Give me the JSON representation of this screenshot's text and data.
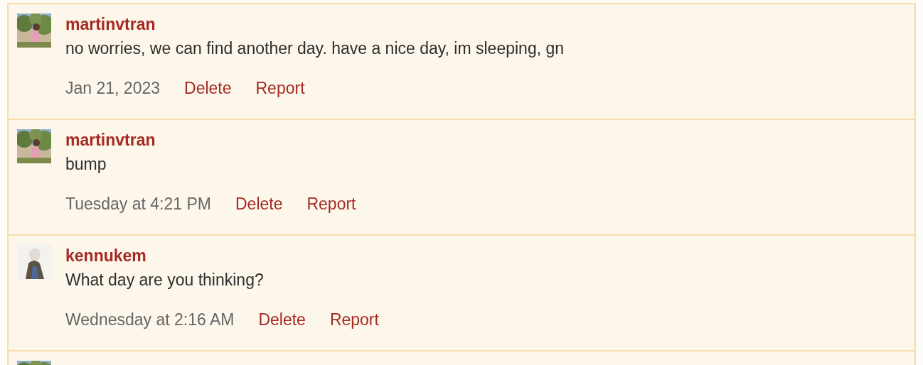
{
  "comments": [
    {
      "avatar": {
        "kind": "picture"
      },
      "username": "martinvtran",
      "text": "no worries, we can find another day. have a nice day, im sleeping, gn",
      "time": "Jan 21, 2023",
      "actions": [
        "Delete",
        "Report"
      ]
    },
    {
      "avatar": {
        "kind": "picture"
      },
      "username": "martinvtran",
      "text": "bump",
      "time": "Tuesday at 4:21 PM",
      "actions": [
        "Delete",
        "Report"
      ]
    },
    {
      "avatar": {
        "kind": "picture"
      },
      "username": "kennukem",
      "text": "What day are you thinking?",
      "time": "Wednesday at 2:16 AM",
      "actions": [
        "Delete",
        "Report"
      ]
    },
    {
      "avatar": {
        "kind": "picture"
      }
    }
  ]
}
